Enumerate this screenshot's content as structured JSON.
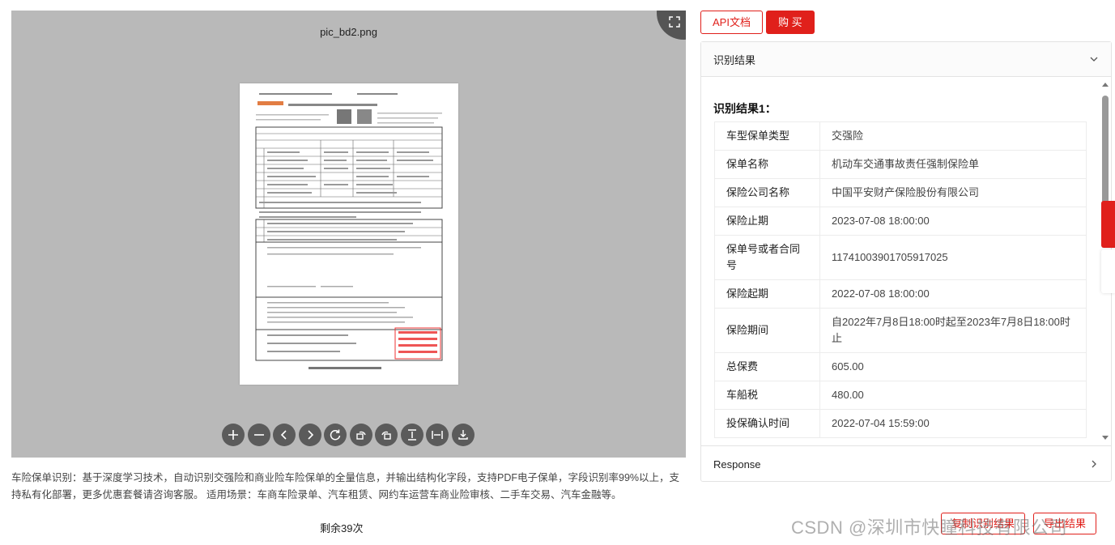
{
  "viewer": {
    "filename": "pic_bd2.png",
    "tools": [
      {
        "icon": "zoom-in-icon"
      },
      {
        "icon": "zoom-out-icon"
      },
      {
        "icon": "prev-icon"
      },
      {
        "icon": "next-icon"
      },
      {
        "icon": "reset-icon"
      },
      {
        "icon": "rotate-left-icon"
      },
      {
        "icon": "rotate-right-icon"
      },
      {
        "icon": "fit-height-icon"
      },
      {
        "icon": "fit-width-icon"
      },
      {
        "icon": "download-icon"
      }
    ]
  },
  "description": "车险保单识别：基于深度学习技术，自动识别交强险和商业险车险保单的全量信息，并输出结构化字段，支持PDF电子保单，字段识别率99%以上，支持私有化部署，更多优惠套餐请咨询客服。 适用场景：车商车险录单、汽车租赁、网约车运营车商业险审核、二手车交易、汽车金融等。",
  "remaining": "剩余39次",
  "top_buttons": {
    "api_doc": "API文档",
    "buy": "购 买"
  },
  "panel": {
    "header": "识别结果",
    "result_title": "识别结果1：",
    "rows": [
      {
        "key": "车型保单类型",
        "value": "交强险"
      },
      {
        "key": "保单名称",
        "value": "机动车交通事故责任强制保险单"
      },
      {
        "key": "保险公司名称",
        "value": "中国平安财产保险股份有限公司"
      },
      {
        "key": "保险止期",
        "value": "2023-07-08 18:00:00"
      },
      {
        "key": "保单号或者合同号",
        "value": "11741003901705917025"
      },
      {
        "key": "保险起期",
        "value": "2022-07-08 18:00:00"
      },
      {
        "key": "保险期间",
        "value": "自2022年7月8日18:00时起至2023年7月8日18:00时止"
      },
      {
        "key": "总保费",
        "value": "605.00"
      },
      {
        "key": "车船税",
        "value": "480.00"
      },
      {
        "key": "投保确认时间",
        "value": "2022-07-04 15:59:00"
      }
    ],
    "footer": "Response"
  },
  "bottom_buttons": {
    "copy": "复制识别结果",
    "export": "导出结果"
  },
  "watermark": "CSDN @深圳市快瞳科技有限公司",
  "colors": {
    "accent": "#e0201b",
    "viewer_bg": "#b9b9b9",
    "tool_bg": "#5b5b5b"
  }
}
